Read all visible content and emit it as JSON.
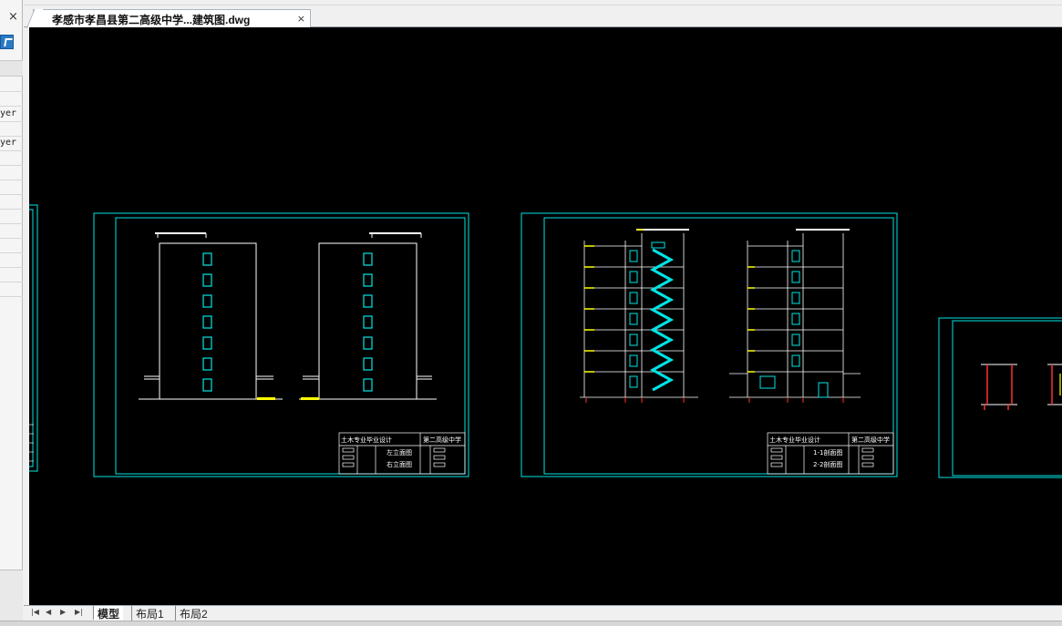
{
  "window": {
    "panel_close_glyph": "×",
    "panel_labels": [
      "yer",
      "yer"
    ]
  },
  "document_tab": {
    "title": "孝感市孝昌县第二高级中学...建筑图.dwg",
    "close_glyph": "×"
  },
  "layout_tabs": {
    "nav": [
      "|◀",
      "◀",
      "▶",
      "▶|"
    ],
    "tabs": [
      {
        "label": "模型",
        "active": true
      },
      {
        "label": "布局1",
        "active": false
      },
      {
        "label": "布局2",
        "active": false
      }
    ]
  },
  "drawing": {
    "sheet1": {
      "titleblock_left": "土木专业毕业设计",
      "titleblock_right": "第二高级中学",
      "row1": "左立面图",
      "row2": "右立面图"
    },
    "sheet2": {
      "titleblock_left": "土木专业毕业设计",
      "titleblock_right": "第二高级中学",
      "row1": "1-1剖面图",
      "row2": "2-2剖面图"
    },
    "colors": {
      "background": "#000000",
      "frame": "#00e5e5",
      "lines": "#ffffff",
      "accent": "#ffff00",
      "dim": "#ff3030"
    }
  }
}
